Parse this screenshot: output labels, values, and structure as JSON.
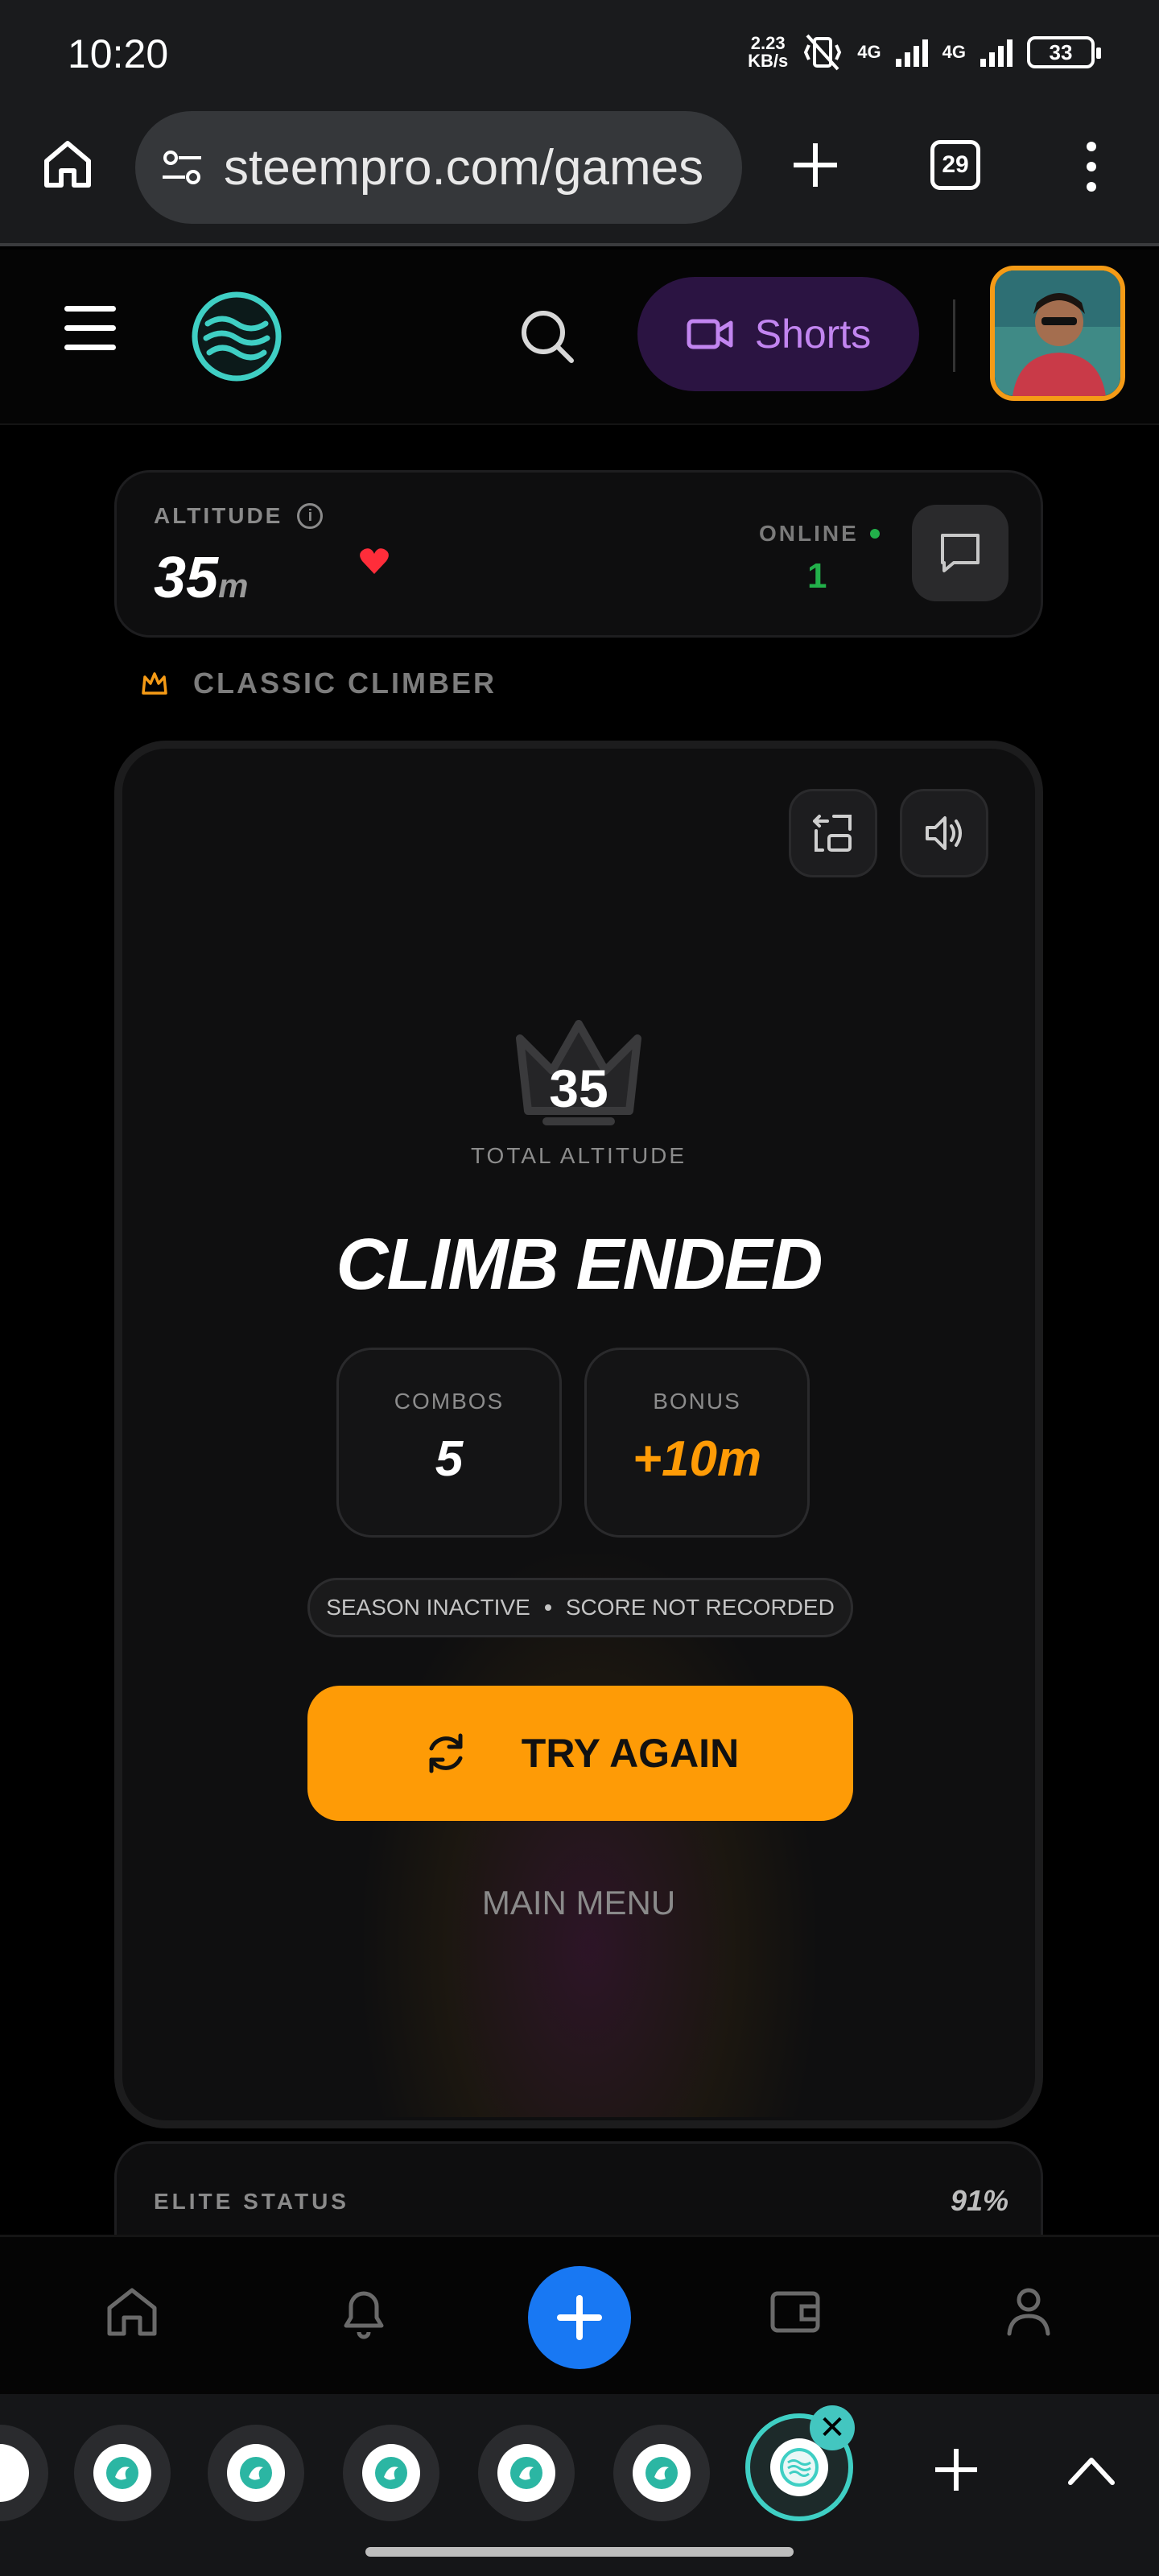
{
  "status_bar": {
    "time": "10:20",
    "speed_value": "2.23",
    "speed_unit": "KB/s",
    "net1": "4G",
    "net2": "4G",
    "battery": "33"
  },
  "browser": {
    "url": "steempro.com/games",
    "tab_count": "29"
  },
  "header": {
    "shorts_label": "Shorts"
  },
  "altitude_card": {
    "label": "ALTITUDE",
    "info_icon": "i",
    "value": "35",
    "unit": "m",
    "online_label": "ONLINE",
    "online_count": "1"
  },
  "mode": {
    "label": "CLASSIC CLIMBER"
  },
  "game": {
    "total_value": "35",
    "total_label": "TOTAL ALTITUDE",
    "title": "CLIMB ENDED",
    "combos_label": "COMBOS",
    "combos_value": "5",
    "bonus_label": "BONUS",
    "bonus_value": "+10m",
    "notice_part1": "SEASON INACTIVE",
    "notice_part2": "SCORE NOT RECORDED",
    "try_again_label": "TRY AGAIN",
    "main_menu_label": "MAIN MENU"
  },
  "elite": {
    "label": "ELITE STATUS",
    "percent": "91%"
  },
  "colors": {
    "accent_orange": "#fe9b06",
    "online_green": "#22b04a",
    "fab_blue": "#1878f3",
    "shorts_purple": "#c285f0",
    "teal": "#3fcfc4"
  },
  "icons": {
    "tab_strip": [
      "steem-tab-icon",
      "steem-tab-icon",
      "steem-tab-icon",
      "steem-tab-icon",
      "steem-tab-icon",
      "steempro-active-tab-icon"
    ],
    "bottom_nav": [
      "home-icon",
      "bell-icon",
      "plus-icon",
      "wallet-icon",
      "user-icon"
    ]
  },
  "tab_strip": {
    "close_symbol": "✕"
  }
}
